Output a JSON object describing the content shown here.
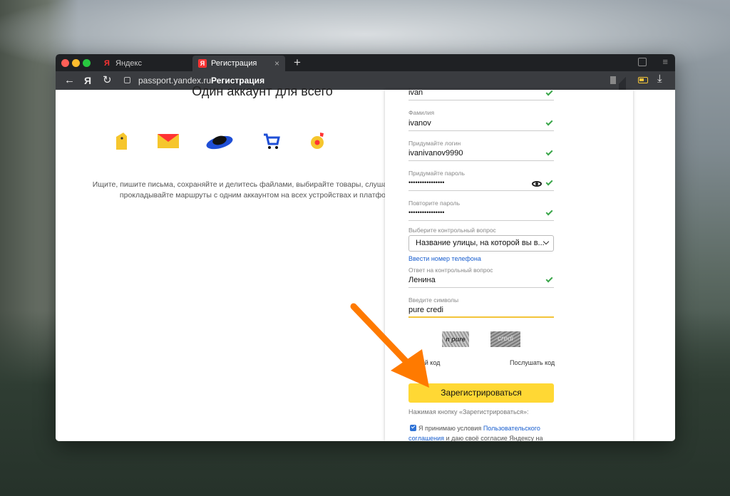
{
  "browser": {
    "tabs": [
      {
        "label": "Яндекс",
        "favicon": "Я"
      },
      {
        "label": "Регистрация",
        "favicon": "Я"
      }
    ],
    "tab_close": "×",
    "new_tab": "+",
    "address": {
      "host": "passport.yandex.ru",
      "page_title": "Регистрация"
    },
    "nav": {
      "back": "←",
      "home": "Я",
      "reload": "↻",
      "download": "⤓",
      "menu": "≡"
    }
  },
  "promo": {
    "title": "Один аккаунт для всего",
    "text": "Ищите, пишите письма, сохраняйте и делитесь файлами, выбирайте товары, слушайте музыку и прокладывайте маршруты с одним аккаунтом на всех устройствах и платформах.",
    "icons": [
      "disk-icon",
      "mail-icon",
      "saucer-icon",
      "cart-icon",
      "music-icon"
    ]
  },
  "form": {
    "first_name_value": "ivan",
    "last_name_label": "Фамилия",
    "last_name_value": "ivanov",
    "login_label": "Придумайте логин",
    "login_value": "ivanivanov9990",
    "password_label": "Придумайте пароль",
    "password_value": "••••••••••••••••",
    "repeat_label": "Повторите пароль",
    "repeat_value": "••••••••••••••••",
    "question_label": "Выберите контрольный вопрос",
    "question_value": "Название улицы, на которой вы в...",
    "phone_link": "Ввести номер телефона",
    "answer_label": "Ответ на контрольный вопрос",
    "answer_value": "Ленина",
    "captcha_label": "Введите символы",
    "captcha_value": "pure credi",
    "captcha_img_1": "n pure",
    "captcha_img_2": "credi",
    "other_code": "другой код",
    "listen_code": "Послушать код",
    "submit": "Зарегистрироваться",
    "hint": "Нажимая кнопку «Зарегистрироваться»:",
    "agree_prefix": "Я принимаю условия",
    "agree_link": "Пользовательского соглашения",
    "agree_suffix": "и даю своё согласие Яндексу на"
  },
  "colors": {
    "accent_yellow": "#ffd834",
    "link_blue": "#1a5fcf",
    "check_green": "#3aa64a",
    "arrow_orange": "#ff7a00"
  }
}
